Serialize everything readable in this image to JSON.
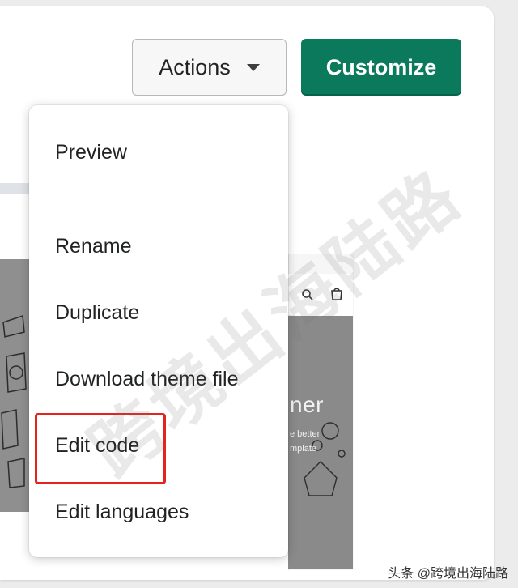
{
  "header": {
    "actions_label": "Actions",
    "customize_label": "Customize"
  },
  "menu": {
    "items": [
      {
        "label": "Preview"
      },
      {
        "label": "Rename"
      },
      {
        "label": "Duplicate"
      },
      {
        "label": "Download theme file"
      },
      {
        "label": "Edit code"
      },
      {
        "label": "Edit languages"
      }
    ]
  },
  "preview": {
    "hero_text": "ner",
    "line1": "e better",
    "line2": "mplate"
  },
  "overlay": {
    "watermark": "跨境出海陆路",
    "credit": "头条 @跨境出海陆路"
  },
  "colors": {
    "primary": "#0b7a5c",
    "highlight": "#e3231e"
  },
  "icons": {
    "dropdown": "caret-down-icon",
    "search": "search-icon",
    "cart": "cart-icon"
  }
}
